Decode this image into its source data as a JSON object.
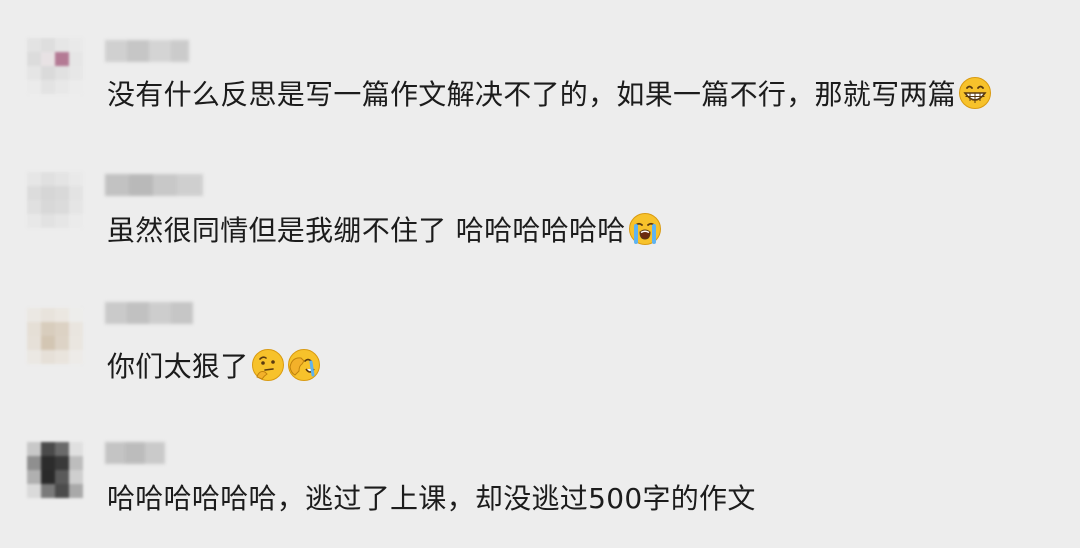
{
  "comments": [
    {
      "avatar": "blurred-avatar-1",
      "username": "blurred",
      "text": "没有什么反思是写一篇作文解决不了的，如果一篇不行，那就写两篇",
      "emojis": [
        "grinning-face-icon"
      ]
    },
    {
      "avatar": "blurred-avatar-2",
      "username": "blurred",
      "text": "虽然很同情但是我绷不住了 哈哈哈哈哈哈",
      "emojis": [
        "loudly-crying-face-icon"
      ]
    },
    {
      "avatar": "blurred-avatar-3",
      "username": "blurred",
      "text": "你们太狠了",
      "emojis": [
        "thinking-face-icon",
        "facepalm-icon"
      ]
    },
    {
      "avatar": "blurred-avatar-4",
      "username": "blurred",
      "text": "哈哈哈哈哈哈，逃过了上课，却没逃过500字的作文",
      "emojis": []
    }
  ],
  "colors": {
    "background": "#ededed",
    "text": "#1c1c1c",
    "emoji_yellow": "#f7c22b"
  }
}
